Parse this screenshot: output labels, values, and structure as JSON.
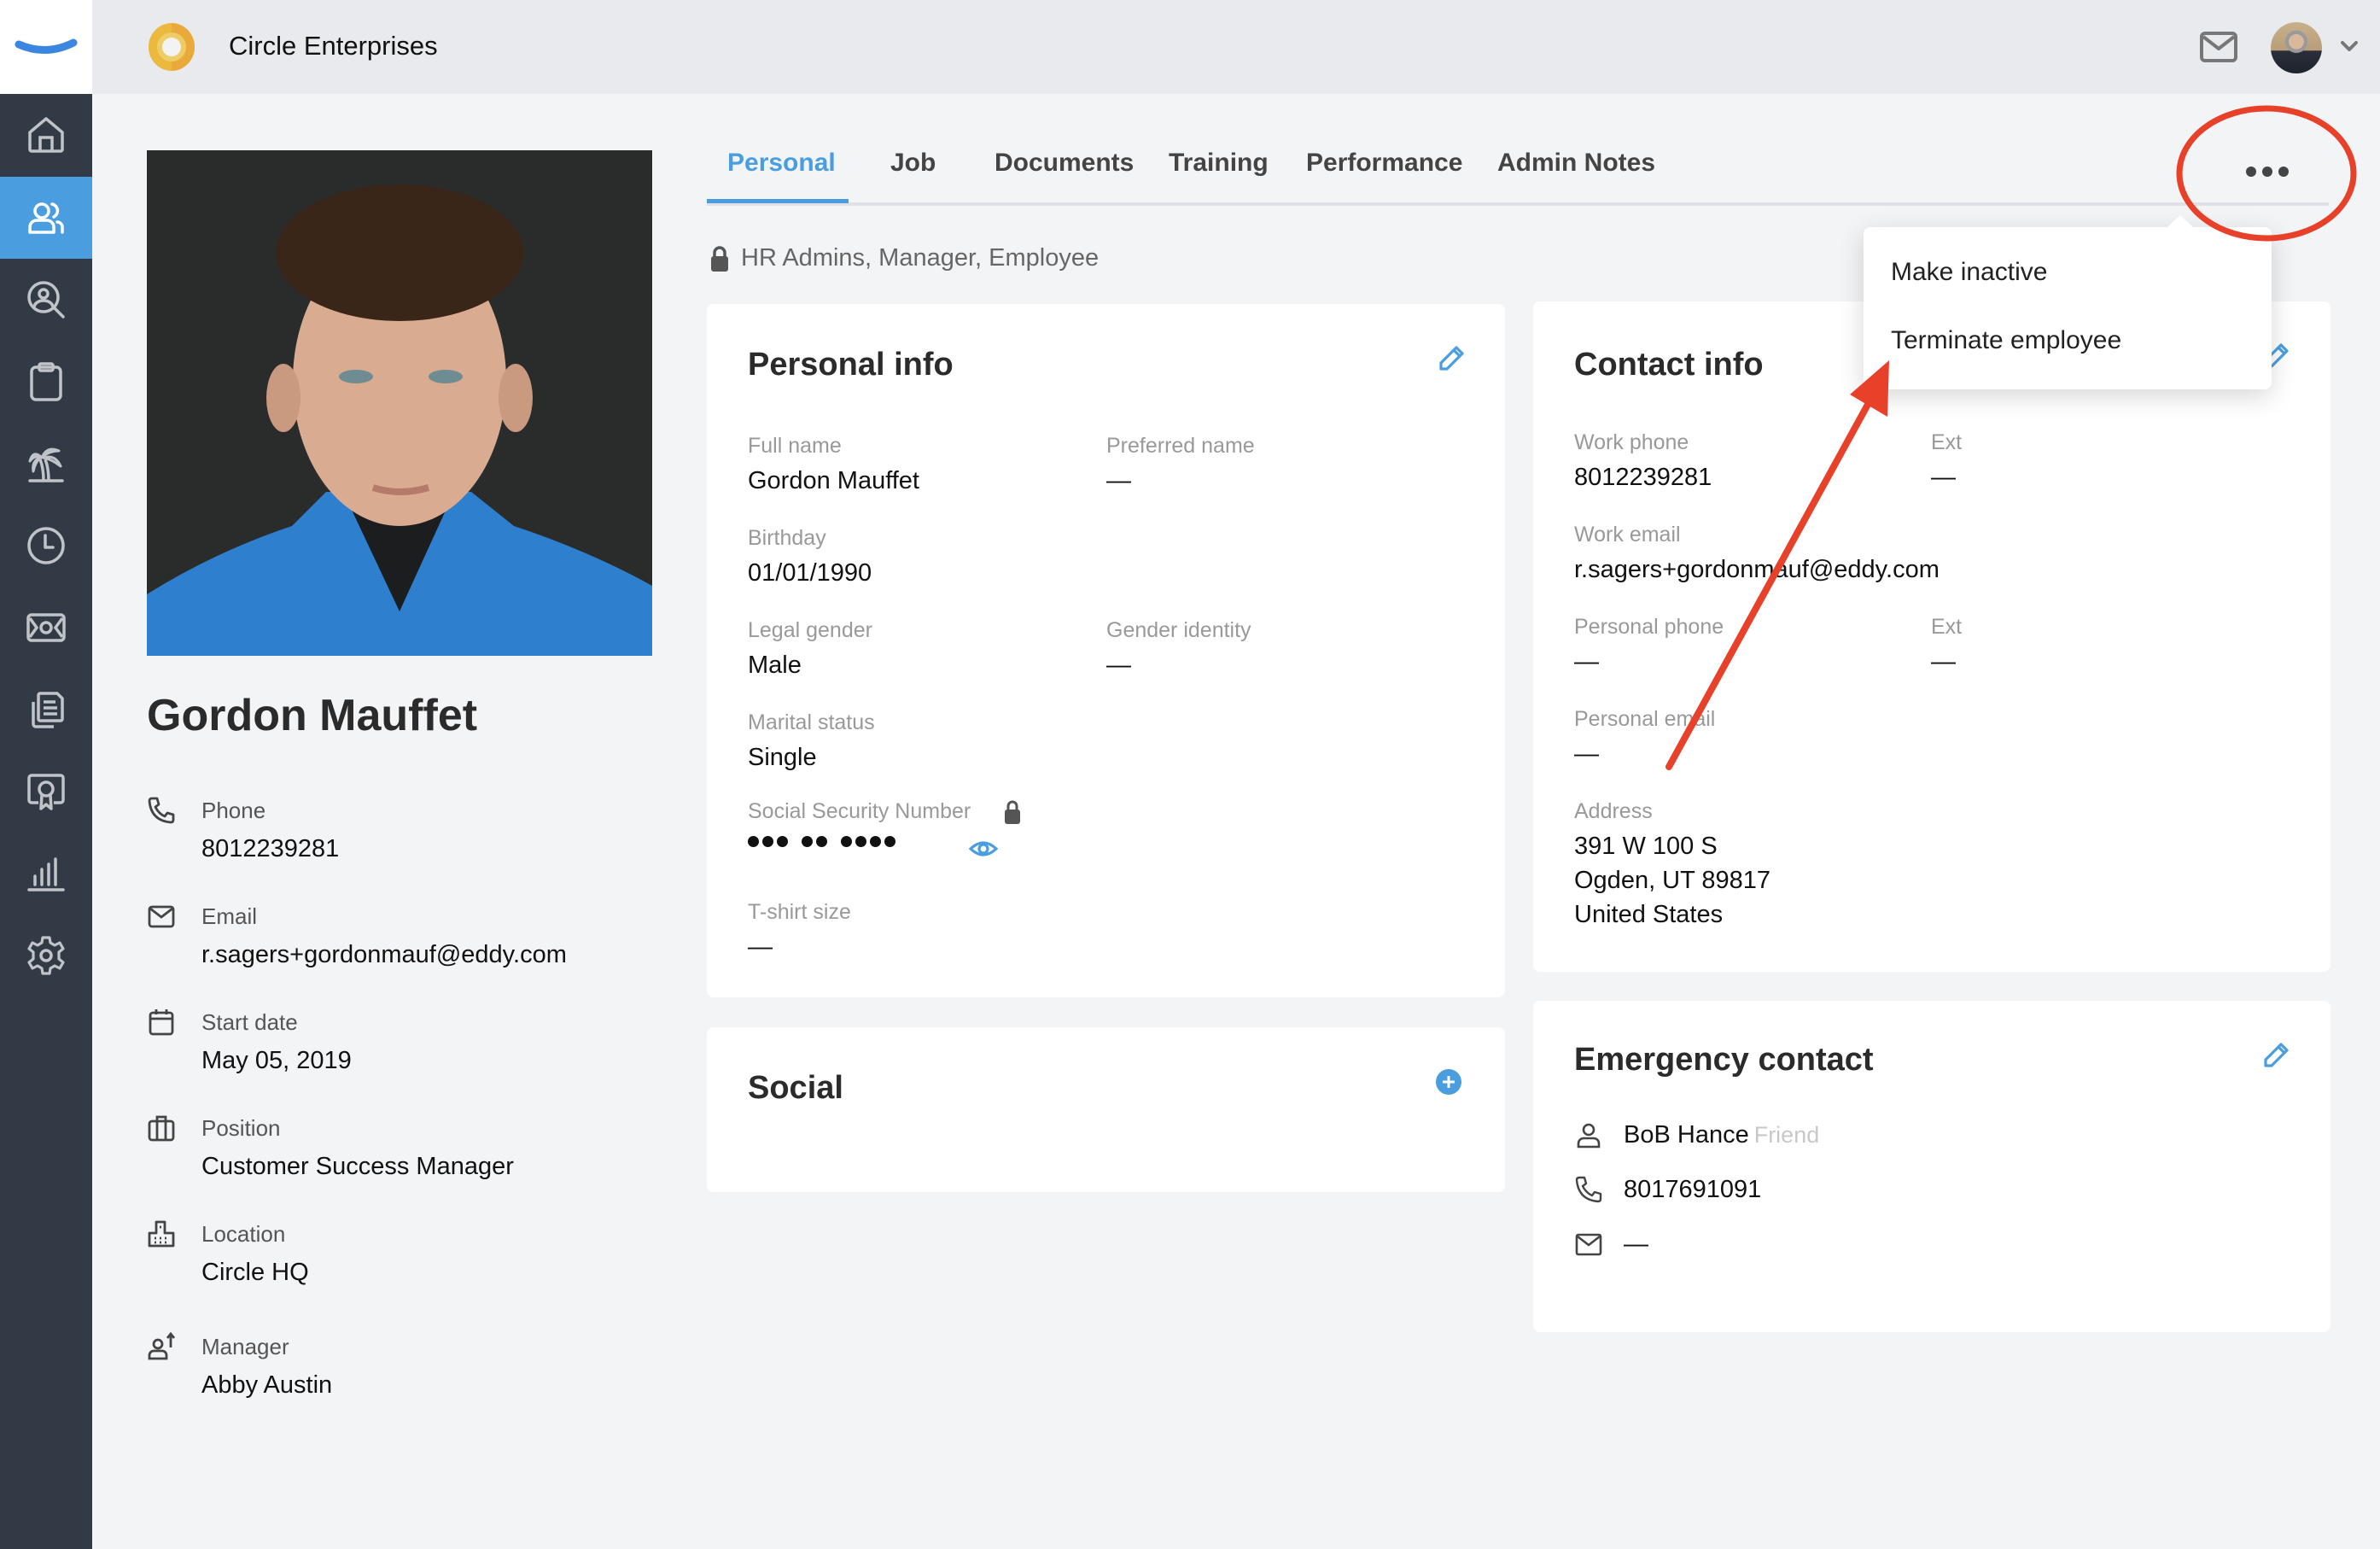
{
  "app": {
    "company_name": "Circle Enterprises",
    "brand_color": "#4a9ee0",
    "sidebar_color": "#323b45"
  },
  "header": {
    "icons": [
      "mail-icon",
      "user-avatar",
      "chevron-down-icon"
    ]
  },
  "sidebar": {
    "items": [
      {
        "name": "home",
        "icon": "home-icon",
        "active": false
      },
      {
        "name": "people",
        "icon": "people-icon",
        "active": true
      },
      {
        "name": "recruiting",
        "icon": "user-search-icon",
        "active": false
      },
      {
        "name": "tasks",
        "icon": "clipboard-icon",
        "active": false
      },
      {
        "name": "time-off",
        "icon": "palm-tree-icon",
        "active": false
      },
      {
        "name": "time-tracking",
        "icon": "clock-icon",
        "active": false
      },
      {
        "name": "payroll",
        "icon": "money-icon",
        "active": false
      },
      {
        "name": "documents",
        "icon": "documents-icon",
        "active": false
      },
      {
        "name": "training",
        "icon": "certificate-icon",
        "active": false
      },
      {
        "name": "reports",
        "icon": "bar-chart-icon",
        "active": false
      },
      {
        "name": "settings",
        "icon": "gear-icon",
        "active": false
      }
    ]
  },
  "profile": {
    "name": "Gordon Mauffet",
    "fields": [
      {
        "label": "Phone",
        "value": "8012239281",
        "icon": "phone-icon"
      },
      {
        "label": "Email",
        "value": "r.sagers+gordonmauf@eddy.com",
        "icon": "mail-icon"
      },
      {
        "label": "Start date",
        "value": "May 05, 2019",
        "icon": "calendar-icon"
      },
      {
        "label": "Position",
        "value": "Customer Success Manager",
        "icon": "briefcase-icon"
      },
      {
        "label": "Location",
        "value": "Circle HQ",
        "icon": "building-icon"
      },
      {
        "label": "Manager",
        "value": "Abby Austin",
        "icon": "manager-icon"
      }
    ]
  },
  "tabs": [
    {
      "label": "Personal",
      "active": true
    },
    {
      "label": "Job",
      "active": false
    },
    {
      "label": "Documents",
      "active": false
    },
    {
      "label": "Training",
      "active": false
    },
    {
      "label": "Performance",
      "active": false
    },
    {
      "label": "Admin Notes",
      "active": false
    }
  ],
  "access_note": "HR Admins, Manager, Employee",
  "more_menu": {
    "items": [
      "Make inactive",
      "Terminate employee"
    ]
  },
  "personal_info": {
    "title": "Personal info",
    "full_name_label": "Full name",
    "full_name": "Gordon Mauffet",
    "preferred_name_label": "Preferred name",
    "preferred_name": "—",
    "birthday_label": "Birthday",
    "birthday": "01/01/1990",
    "legal_gender_label": "Legal gender",
    "legal_gender": "Male",
    "gender_identity_label": "Gender identity",
    "gender_identity": "—",
    "marital_status_label": "Marital status",
    "marital_status": "Single",
    "ssn_label": "Social Security Number",
    "ssn_masked": "••• •• ••••",
    "tshirt_label": "T-shirt size",
    "tshirt": "—"
  },
  "social": {
    "title": "Social"
  },
  "contact_info": {
    "title": "Contact info",
    "work_phone_label": "Work phone",
    "work_phone": "8012239281",
    "work_ext_label": "Ext",
    "work_ext": "—",
    "work_email_label": "Work email",
    "work_email": "r.sagers+gordonmauf@eddy.com",
    "personal_phone_label": "Personal phone",
    "personal_phone": "—",
    "personal_ext_label": "Ext",
    "personal_ext": "—",
    "personal_email_label": "Personal email",
    "personal_email": "—",
    "address_label": "Address",
    "address_line1": "391 W 100 S",
    "address_line2": "Ogden, UT 89817",
    "address_line3": "United States"
  },
  "emergency_contact": {
    "title": "Emergency contact",
    "name": "BoB Hance",
    "relationship": "Friend",
    "phone": "8017691091",
    "email": "—"
  },
  "annotation": {
    "color": "#e8412a",
    "circle_target": "more-options-button",
    "arrow_target": "Terminate employee"
  }
}
